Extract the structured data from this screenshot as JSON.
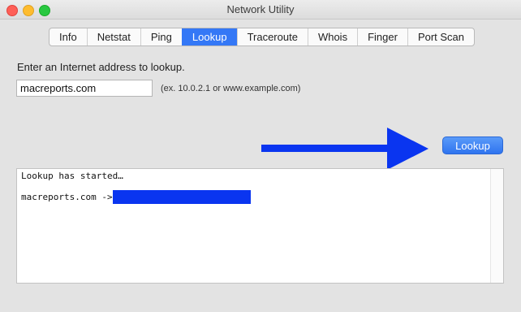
{
  "window": {
    "title": "Network Utility"
  },
  "tabs": [
    {
      "label": "Info",
      "active": false
    },
    {
      "label": "Netstat",
      "active": false
    },
    {
      "label": "Ping",
      "active": false
    },
    {
      "label": "Lookup",
      "active": true
    },
    {
      "label": "Traceroute",
      "active": false
    },
    {
      "label": "Whois",
      "active": false
    },
    {
      "label": "Finger",
      "active": false
    },
    {
      "label": "Port Scan",
      "active": false
    }
  ],
  "lookup": {
    "prompt": "Enter an Internet address to lookup.",
    "address_value": "macreports.com",
    "address_hint": "(ex. 10.0.2.1 or www.example.com)",
    "button_label": "Lookup"
  },
  "output": {
    "lines": [
      "Lookup has started…",
      "macreports.com ->"
    ]
  },
  "annotation": {
    "arrow_color": "#0a35f0",
    "redaction_color": "#0a35f0"
  }
}
